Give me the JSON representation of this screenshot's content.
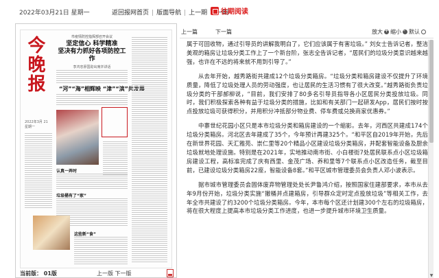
{
  "topbar": {
    "date": "2022年03月21日 星期一",
    "nav_home": "返回报网首页",
    "nav_layout": "版面导航",
    "nav_prev": "上一期",
    "nav_next": "下一期",
    "past_label": "往期阅读",
    "past_icon": "calendar-icon"
  },
  "thumbnail": {
    "brand": "今晚报",
    "date_text": "2022年3月 21 星期一",
    "kicker": "市疫情防控指挥部召开会议",
    "headline_1": "坚定信心 科学精准",
    "headline_2": "坚决有力抓好各项防控工作",
    "subhead": "李鸿忠廖国勋出席并讲话",
    "h3": "“河”“海”相辉映 “津”“滨”共发展",
    "small_heads": [
      "认真一弄时",
      "垃圾桶有了“家”",
      "这些新“食”"
    ]
  },
  "left_footer": {
    "current": "当前版： 01版",
    "prev_page": "上一版",
    "next_page": "下一版",
    "pdf_icon": "pdf-icon"
  },
  "right_toolbar": {
    "prev": "上一篇",
    "next": "下一篇",
    "zoom_in": "放大",
    "zoom_out": "缩小",
    "zoom_reset": "默认"
  },
  "article": {
    "paragraphs": [
      "属于可回收物，通过引导员的讲解我明白了，它们应该属于有害垃圾。” 刘女士告诉记者，整洁美观的箱房让垃圾分类工作上了一个新台阶，张志全告诉记者，“居民们的垃圾分类意识越来越强，也许在不远的将来就不用到引导了。”",
      "从去年开始，越秀路街共建成12个垃圾分类箱房。“垃圾分类和箱房建设不仅提升了环境质量，降低了垃圾处理人员的劳动强度，也让居民的生活习惯有了很大改变。”越秀路街负责垃圾分类的干部郝柳说，“目前，我们安排了80多名引导员指导各小区居民分类投放垃圾。同时，我们积极探索各种有益于垃圾分类的措施，比如和有关部门一起研发App，居民们按时按点投放垃圾可获得积分，并用积分冲抵部分物业费、停车费或兑换商家优惠券。”",
      "中寨世纪花园小区只是本市垃圾分类和箱房建设的一个缩影。去年，河西区共建成174个垃圾分类箱房。河北区去年建成了35个，今年预计再建325个。“和平区自2019年开始，先后在新世界花园、天汇雅苑、崇仁里等20个精品小区建设垃圾分类箱房，并配套智能设备及厨余垃圾就地处理设施。特别是在2021年，实地推动南市街、小白楼街7处居民联系点小区垃圾箱房建设工程，高标准完成了庆有西里、金茂广场、养和里等7个联系点小区改造任务，截至目前，已建设垃圾分类箱房22座，智能设备8套。”和平区城市管理委员会负责人邓小波表示。",
      "据市城市管理委员会固体废弃物管理处处长尹鲁鸿介绍，按照国家住建部要求，本市从去年9月份开始，垃圾分类实施“撤桶并点建箱房，引导群众定时定点投放垃圾”等相关工作，去年全市共建设了约3200个垃圾分类箱房。今年，本市每个区还计划建300个左右的垃圾箱房，将在很大程度上提高本市垃圾分类工作进度，也进一步提升城市环境卫生质量。"
    ]
  }
}
